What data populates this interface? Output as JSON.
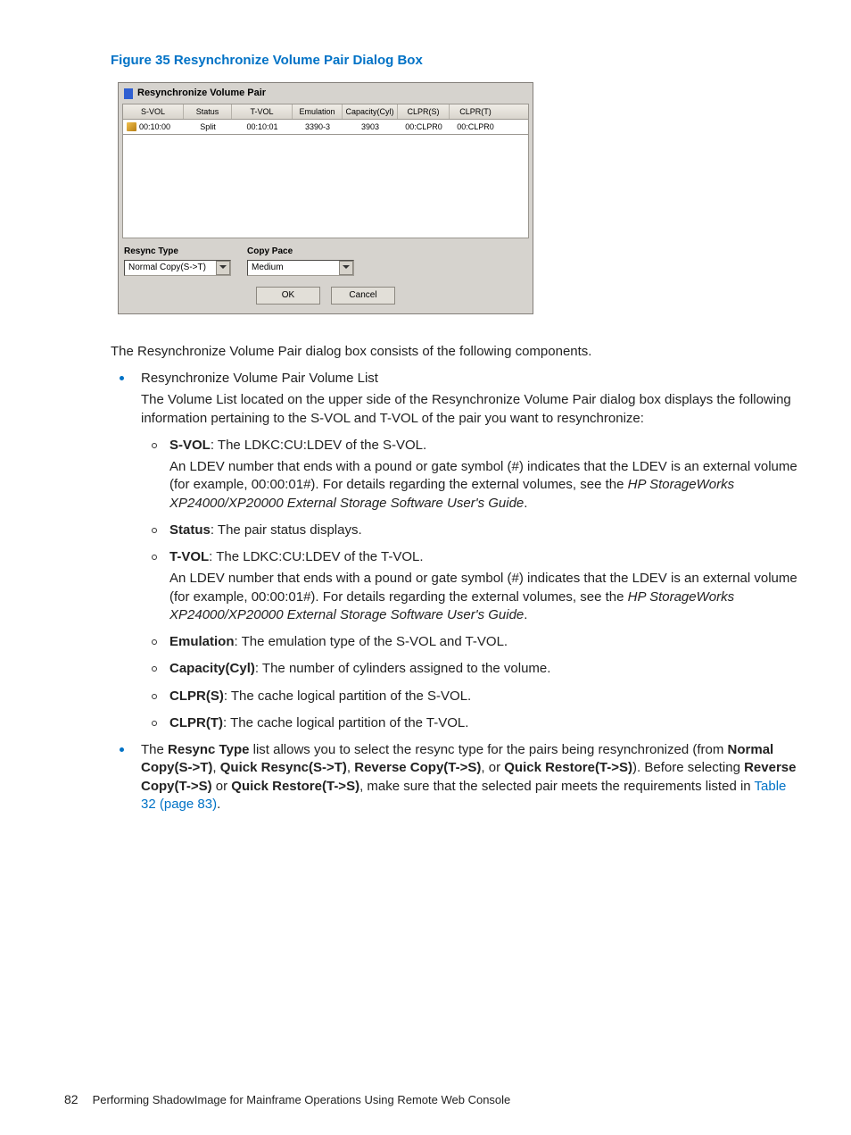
{
  "figure": {
    "label": "Figure 35 Resynchronize Volume Pair Dialog Box"
  },
  "dialog": {
    "title": "Resynchronize Volume Pair",
    "columns": [
      "S-VOL",
      "Status",
      "T-VOL",
      "Emulation",
      "Capacity(Cyl)",
      "CLPR(S)",
      "CLPR(T)"
    ],
    "row": {
      "svol": "00:10:00",
      "status": "Split",
      "tvol": "00:10:01",
      "emu": "3390-3",
      "cap": "3903",
      "clprs": "00:CLPR0",
      "clprt": "00:CLPR0"
    },
    "resync_type": {
      "label": "Resync Type",
      "value": "Normal Copy(S->T)"
    },
    "copy_pace": {
      "label": "Copy Pace",
      "value": "Medium"
    },
    "ok": "OK",
    "cancel": "Cancel"
  },
  "intro": "The Resynchronize Volume Pair dialog box consists of the following components.",
  "bullet1": {
    "title": "Resynchronize Volume Pair Volume List",
    "desc": "The Volume List located on the upper side of the Resynchronize Volume Pair dialog box displays the following information pertaining to the S-VOL and T-VOL of the pair you want to resynchronize:",
    "svol": {
      "label": "S-VOL",
      "text": ": The LDKC:CU:LDEV of the S-VOL.",
      "para1": "An LDEV number that ends with a pound or gate symbol (#) indicates that the LDEV is an external volume (for example, 00:00:01#). For details regarding the external volumes, see the ",
      "para_em": "HP StorageWorks XP24000/XP20000 External Storage Software User's Guide",
      "para_end": "."
    },
    "status": {
      "label": "Status",
      "text": ": The pair status displays."
    },
    "tvol": {
      "label": "T-VOL",
      "text": ": The LDKC:CU:LDEV of the T-VOL.",
      "para1": "An LDEV number that ends with a pound or gate symbol (#) indicates that the LDEV is an external volume (for example, 00:00:01#). For details regarding the external volumes, see the ",
      "para_em": "HP StorageWorks XP24000/XP20000 External Storage Software User's Guide",
      "para_end": "."
    },
    "emu": {
      "label": "Emulation",
      "text": ": The emulation type of the S-VOL and T-VOL."
    },
    "cap": {
      "label": "Capacity(Cyl)",
      "text": ": The number of cylinders assigned to the volume."
    },
    "clprs": {
      "label": "CLPR(S)",
      "text": ": The cache logical partition of the S-VOL."
    },
    "clprt": {
      "label": "CLPR(T)",
      "text": ": The cache logical partition of the T-VOL."
    }
  },
  "bullet2": {
    "t1": "The ",
    "b1": "Resync Type",
    "t2": " list allows you to select the resync type for the pairs being resynchronized (from ",
    "b2": "Normal Copy(S->T)",
    "c1": ", ",
    "b3": "Quick Resync(S->T)",
    "c2": ", ",
    "b4": "Reverse Copy(T->S)",
    "c3": ", or ",
    "b5": "Quick Restore(T->S)",
    "c4": "). Before selecting ",
    "b6": "Reverse Copy(T->S)",
    "c5": " or ",
    "b7": "Quick Restore(T->S)",
    "c6": ", make sure that the selected pair meets the requirements listed in ",
    "link": "Table 32 (page 83)",
    "end": "."
  },
  "footer": {
    "page": "82",
    "text": "Performing ShadowImage for Mainframe Operations Using Remote Web Console"
  }
}
